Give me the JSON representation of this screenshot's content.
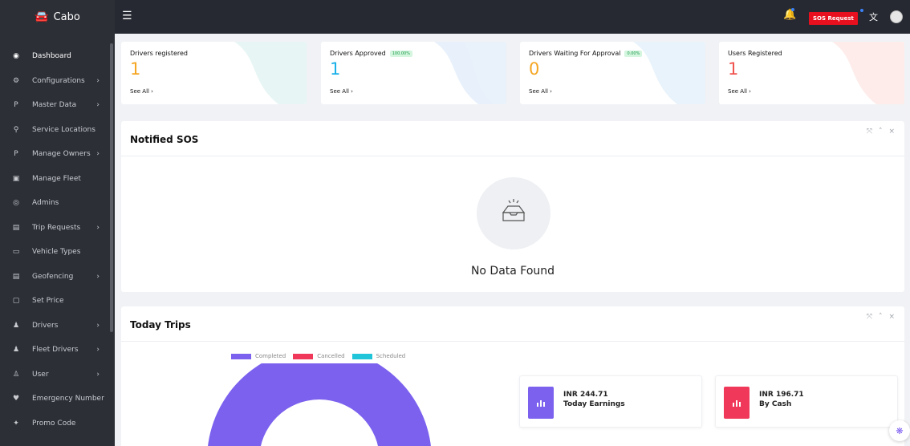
{
  "brand": {
    "name": "Cabo"
  },
  "sidebar": {
    "items": [
      {
        "label": "Dashboard",
        "icon": "dashboard-icon",
        "glyph": "◉",
        "chev": ""
      },
      {
        "label": "Configurations",
        "icon": "gears-icon",
        "glyph": "⚙",
        "chev": "›"
      },
      {
        "label": "Master Data",
        "icon": "paypal-icon",
        "glyph": "P",
        "chev": "›"
      },
      {
        "label": "Service Locations",
        "icon": "map-marker-icon",
        "glyph": "⚲",
        "chev": ""
      },
      {
        "label": "Manage Owners",
        "icon": "paypal-icon",
        "glyph": "P",
        "chev": "›"
      },
      {
        "label": "Manage Fleet",
        "icon": "bus-icon",
        "glyph": "▣",
        "chev": ""
      },
      {
        "label": "Admins",
        "icon": "user-circle-icon",
        "glyph": "◎",
        "chev": ""
      },
      {
        "label": "Trip Requests",
        "icon": "map-icon",
        "glyph": "▤",
        "chev": "›"
      },
      {
        "label": "Vehicle Types",
        "icon": "car-icon",
        "glyph": "▭",
        "chev": ""
      },
      {
        "label": "Geofencing",
        "icon": "map-icon",
        "glyph": "▤",
        "chev": "›"
      },
      {
        "label": "Set Price",
        "icon": "money-icon",
        "glyph": "▢",
        "chev": ""
      },
      {
        "label": "Drivers",
        "icon": "users-icon",
        "glyph": "♟",
        "chev": "›"
      },
      {
        "label": "Fleet Drivers",
        "icon": "users-icon",
        "glyph": "♟",
        "chev": "›"
      },
      {
        "label": "User",
        "icon": "user-icon",
        "glyph": "♙",
        "chev": "›"
      },
      {
        "label": "Emergency Number",
        "icon": "heartbeat-icon",
        "glyph": "♥",
        "chev": ""
      },
      {
        "label": "Promo Code",
        "icon": "gift-icon",
        "glyph": "✦",
        "chev": ""
      }
    ]
  },
  "topbar": {
    "menu_icon": "☰",
    "bell_icon": "🔔",
    "sos_label": "SOS Request",
    "lang_icon": "文"
  },
  "stats": [
    {
      "title": "Drivers registered",
      "badge": "",
      "value": "1",
      "link": "See All ›",
      "color": "#f5a623"
    },
    {
      "title": "Drivers Approved",
      "badge": "100.00%",
      "value": "1",
      "link": "See All ›",
      "color": "#1ab0e8"
    },
    {
      "title": "Drivers Waiting For Approval",
      "badge": "0.00%",
      "value": "0",
      "link": "See All ›",
      "color": "#f5a623"
    },
    {
      "title": "Users Registered",
      "badge": "",
      "value": "1",
      "link": "See All ›",
      "color": "#f0544f"
    }
  ],
  "sos_panel": {
    "title": "Notified SOS",
    "tools": [
      "⤧",
      "˄",
      "×"
    ],
    "empty_icon": "inbox-icon",
    "empty_text": "No Data Found"
  },
  "trips_panel": {
    "title": "Today Trips",
    "tools": [
      "⤧",
      "˄",
      "×"
    ],
    "legend": [
      {
        "label": "Completed",
        "color": "#7b61ee"
      },
      {
        "label": "Cancelled",
        "color": "#f0385a"
      },
      {
        "label": "Scheduled",
        "color": "#21c5d9"
      }
    ],
    "earnings": [
      {
        "amount": "INR 244.71",
        "label": "Today Earnings",
        "color": "#7b61ee"
      },
      {
        "amount": "INR 196.71",
        "label": "By Cash",
        "color": "#f0385a"
      }
    ]
  },
  "colors": {
    "sidebar_bg": "#2c2f36",
    "topbar_bg": "#262932",
    "sos": "#e8101e",
    "page_bg": "#f1f2f5"
  }
}
